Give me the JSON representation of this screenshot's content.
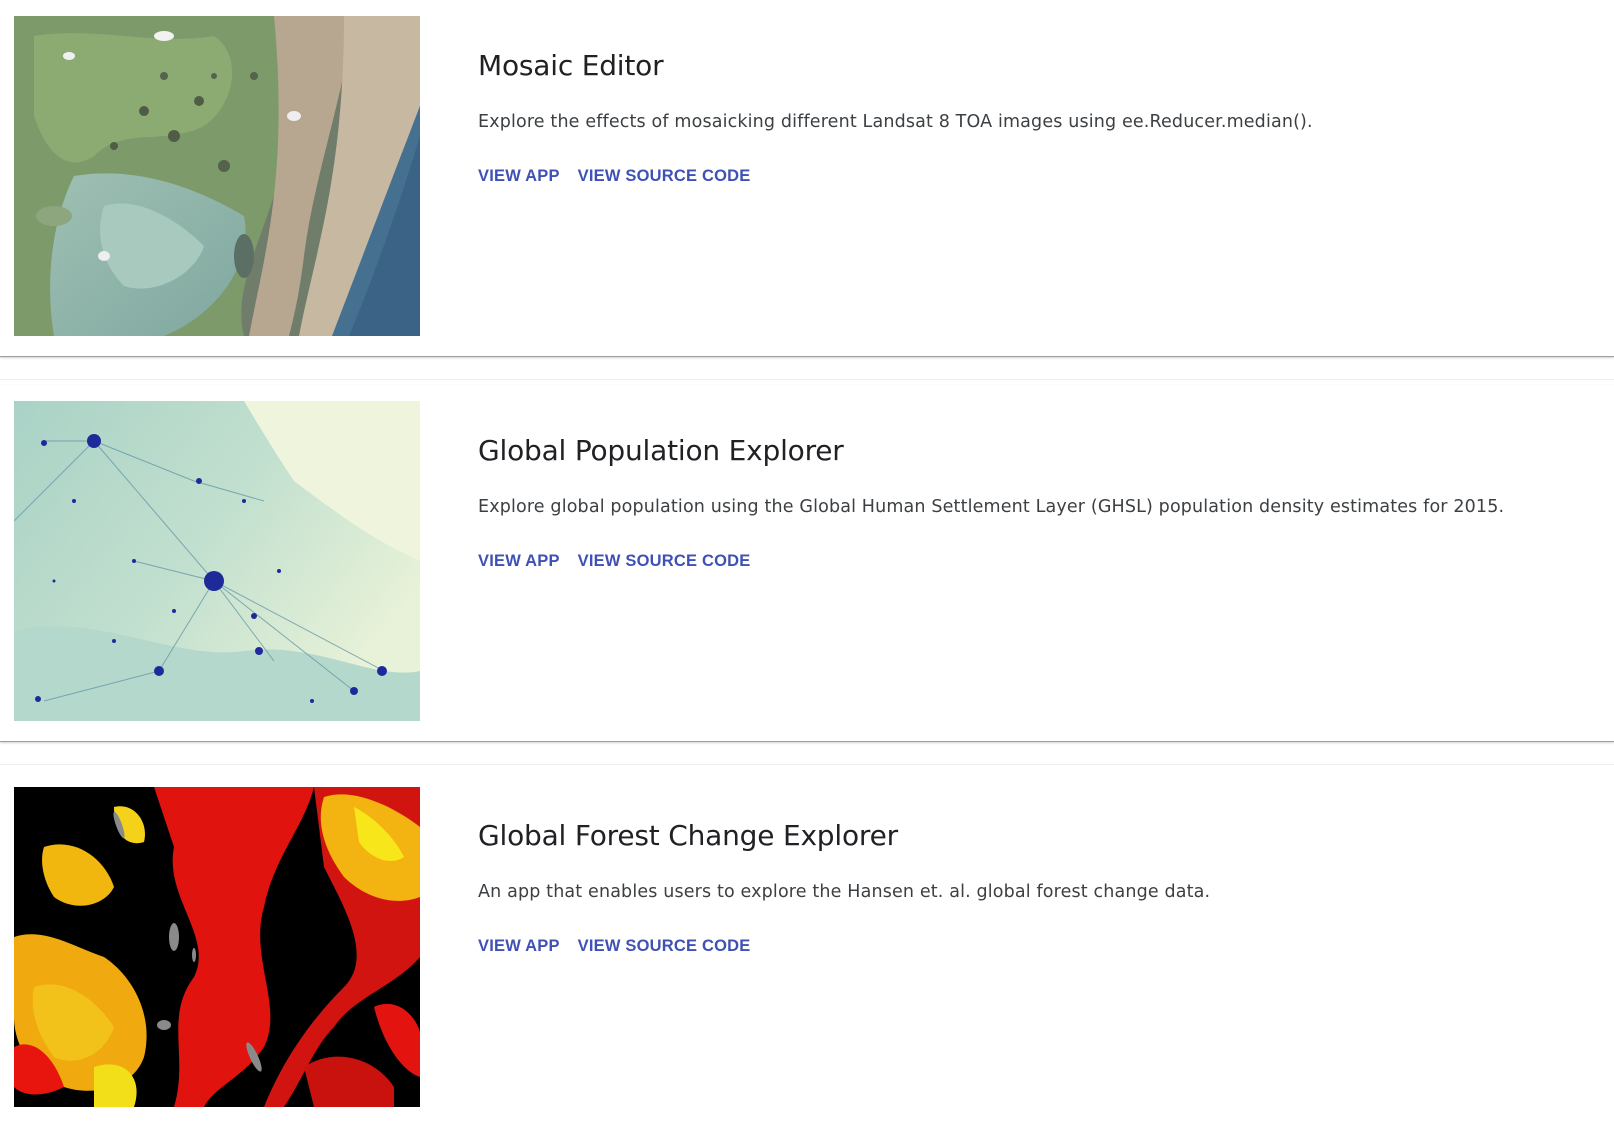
{
  "apps": [
    {
      "title": "Mosaic Editor",
      "description": "Explore the effects of mosaicking different Landsat 8 TOA images using ee.Reducer.median().",
      "view_app_label": "VIEW APP",
      "view_source_label": "VIEW SOURCE CODE",
      "thumbnail": "satellite-coastline-image"
    },
    {
      "title": "Global Population Explorer",
      "description": "Explore global population using the Global Human Settlement Layer (GHSL) population density estimates for 2015.",
      "view_app_label": "VIEW APP",
      "view_source_label": "VIEW SOURCE CODE",
      "thumbnail": "population-density-map-image"
    },
    {
      "title": "Global Forest Change Explorer",
      "description": "An app that enables users to explore the Hansen et. al. global forest change data.",
      "view_app_label": "VIEW APP",
      "view_source_label": "VIEW SOURCE CODE",
      "thumbnail": "forest-change-map-image"
    }
  ],
  "colors": {
    "link": "#3f51b5",
    "title": "#202124",
    "description": "#3c4043"
  }
}
